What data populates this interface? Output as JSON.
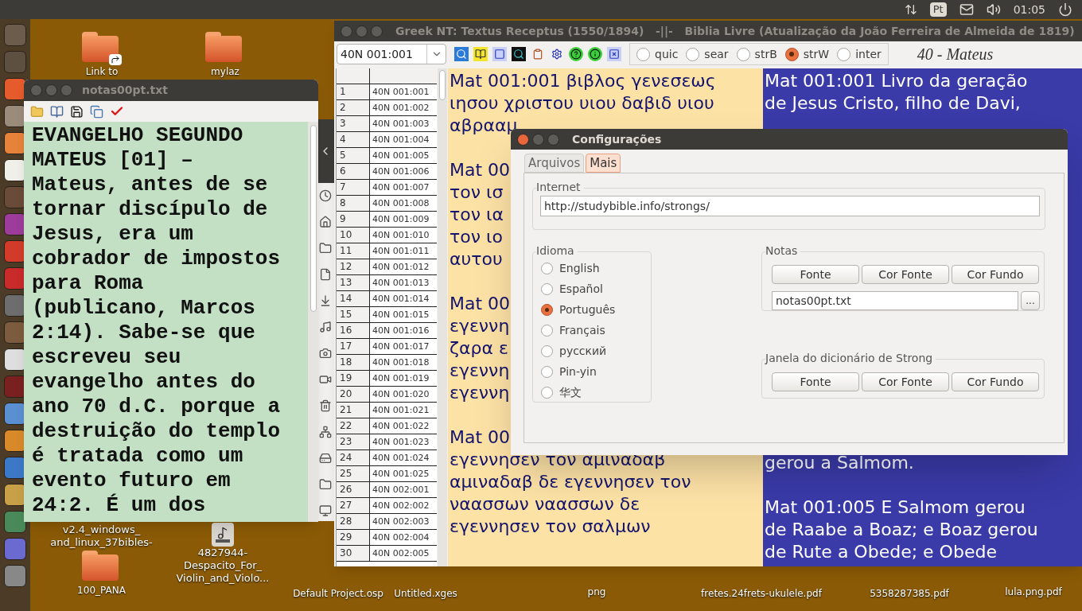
{
  "top_panel": {
    "keyboard_layout": "Pt",
    "clock": "01:05"
  },
  "desktop_icons": [
    {
      "kind": "folder",
      "label": "Link to",
      "link": true
    },
    {
      "kind": "folder",
      "label": "mylaz",
      "link": false
    },
    {
      "kind": "hidden",
      "label": "v2.4_windows_ and_linux_37bibles-"
    },
    {
      "kind": "audio",
      "label": "4827944- Despacito_For_ Violin_and_Violo..."
    },
    {
      "kind": "folder",
      "label": "100_PANA",
      "link": false
    },
    {
      "kind": "hidden",
      "label": "Default Project.osp"
    },
    {
      "kind": "hidden",
      "label": "Untitled.xges"
    },
    {
      "kind": "hidden",
      "label": "png"
    },
    {
      "kind": "hidden",
      "label": "fretes.24frets-ukulele.pdf"
    },
    {
      "kind": "hidden",
      "label": "5358287385.pdf"
    },
    {
      "kind": "hidden",
      "label": "lula.png.pdf"
    }
  ],
  "notes_window": {
    "title": "notas00pt.txt",
    "text": "EVANGELHO SEGUNDO MATEUS [01] – Mateus, antes de se tornar discípulo de Jesus, era um cobrador de impostos para Roma (publicano, Marcos 2:14). Sabe-se que escreveu seu evangelho antes do ano 70 d.C. porque a destruição do templo é tratada como um evento futuro em 24:2. É um dos"
  },
  "main_window": {
    "title": "Greek NT: Textus Receptus (1550/1894)   -||-   Biblia Livre (Atualização da João Ferreira de Almeida de 1819)",
    "reference": "40N 001:001",
    "modes": [
      {
        "label": "quic",
        "selected": false
      },
      {
        "label": "sear",
        "selected": false
      },
      {
        "label": "strB",
        "selected": false
      },
      {
        "label": "strW",
        "selected": true
      },
      {
        "label": "inter",
        "selected": false
      }
    ],
    "book": "40 - Mateus",
    "verse_rows": [
      {
        "number": "1",
        "reference": "40N 001:001"
      },
      {
        "number": "2",
        "reference": "40N 001:002"
      },
      {
        "number": "3",
        "reference": "40N 001:003"
      },
      {
        "number": "4",
        "reference": "40N 001:004"
      },
      {
        "number": "5",
        "reference": "40N 001:005"
      },
      {
        "number": "6",
        "reference": "40N 001:006"
      },
      {
        "number": "7",
        "reference": "40N 001:007"
      },
      {
        "number": "8",
        "reference": "40N 001:008"
      },
      {
        "number": "9",
        "reference": "40N 001:009"
      },
      {
        "number": "10",
        "reference": "40N 001:010"
      },
      {
        "number": "11",
        "reference": "40N 001:011"
      },
      {
        "number": "12",
        "reference": "40N 001:012"
      },
      {
        "number": "13",
        "reference": "40N 001:013"
      },
      {
        "number": "14",
        "reference": "40N 001:014"
      },
      {
        "number": "15",
        "reference": "40N 001:015"
      },
      {
        "number": "16",
        "reference": "40N 001:016"
      },
      {
        "number": "17",
        "reference": "40N 001:017"
      },
      {
        "number": "18",
        "reference": "40N 001:018"
      },
      {
        "number": "19",
        "reference": "40N 001:019"
      },
      {
        "number": "20",
        "reference": "40N 001:020"
      },
      {
        "number": "21",
        "reference": "40N 001:021"
      },
      {
        "number": "22",
        "reference": "40N 001:022"
      },
      {
        "number": "23",
        "reference": "40N 001:023"
      },
      {
        "number": "24",
        "reference": "40N 001:024"
      },
      {
        "number": "25",
        "reference": "40N 001:025"
      },
      {
        "number": "26",
        "reference": "40N 002:001"
      },
      {
        "number": "27",
        "reference": "40N 002:002"
      },
      {
        "number": "28",
        "reference": "40N 002:003"
      },
      {
        "number": "29",
        "reference": "40N 002:004"
      },
      {
        "number": "30",
        "reference": "40N 002:005"
      }
    ],
    "greek_text": [
      [
        "Mat 001:001 βιβλος γενεσεως",
        "ιησου χριστου υιου δαβιδ υιου",
        "αβρααμ"
      ],
      [
        "Mat 00",
        "τον ισ",
        "τον ια",
        "τον ιο",
        "αυτου"
      ],
      [
        "Mat 00",
        "εγεννη",
        "ζαρα ε",
        "εγεννη",
        "εγεννη"
      ],
      [
        "Mat 00",
        "εγεννησεν τον αμιναδαβ",
        "αμιναδαβ δε εγεννησεν τον",
        "ναασσων ναασσων δε",
        "εγεννησεν τον σαλμων"
      ]
    ],
    "portuguese_text_top": [
      [
        "Mat 001:001 Livro da geração",
        "de Jesus Cristo, filho de Davi,"
      ]
    ],
    "portuguese_text_bottom": [
      [
        "gerou a Salmom."
      ],
      [
        "Mat 001:005 E Salmom gerou",
        "de Raabe a Boaz; e Boaz gerou",
        "de Rute a Obede; e Obede"
      ]
    ]
  },
  "settings_dialog": {
    "title": "Configurações",
    "tabs": [
      {
        "label": "Arquivos",
        "selected": false
      },
      {
        "label": "Mais",
        "selected": true
      }
    ],
    "internet": {
      "legend": "Internet",
      "url": "http://studybible.info/strongs/"
    },
    "language": {
      "legend": "Idioma",
      "options": [
        {
          "label": "English",
          "selected": false
        },
        {
          "label": "Español",
          "selected": false
        },
        {
          "label": "Português",
          "selected": true
        },
        {
          "label": "Français",
          "selected": false
        },
        {
          "label": "русский",
          "selected": false
        },
        {
          "label": "Pin-yin",
          "selected": false
        },
        {
          "label": "华文",
          "selected": false
        }
      ]
    },
    "notes": {
      "legend": "Notas",
      "buttons": [
        "Fonte",
        "Cor Fonte",
        "Cor Fundo"
      ],
      "file": "notas00pt.txt",
      "browse": "..."
    },
    "strong_window": {
      "legend": "Janela do dicionário de Strong",
      "buttons": [
        "Fonte",
        "Cor Fonte",
        "Cor Fundo"
      ]
    }
  }
}
